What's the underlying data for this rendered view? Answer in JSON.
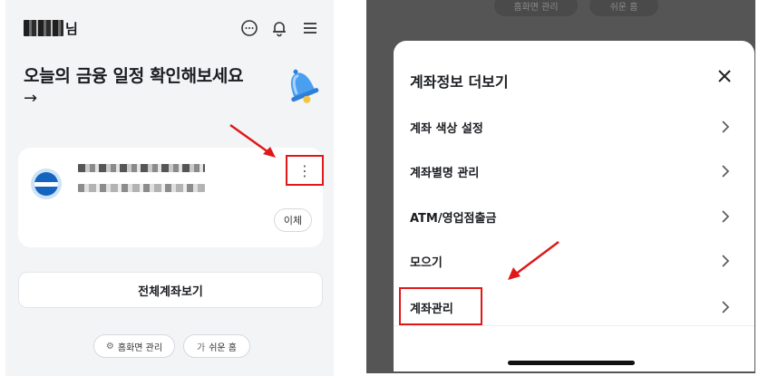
{
  "left": {
    "header": {
      "user_suffix": "님",
      "icons": [
        "chat-icon",
        "bell-icon",
        "menu-icon"
      ]
    },
    "headline": "오늘의 금융 일정 확인해보세요",
    "headline_arrow": "→",
    "account_card": {
      "more_glyph": "⋮",
      "transfer_label": "이체"
    },
    "all_accounts_label": "전체계좌보기",
    "chips": [
      {
        "glyph": "⚙",
        "label": "홈화면 관리"
      },
      {
        "glyph": "가",
        "label": "쉬운 홈"
      }
    ]
  },
  "right": {
    "background_chips": [
      "홈화면 관리",
      "쉬운 홈"
    ],
    "sheet": {
      "title": "계좌정보 더보기",
      "close_glyph": "✕",
      "items": [
        {
          "label": "계좌 색상 설정"
        },
        {
          "label": "계좌별명 관리"
        },
        {
          "label": "ATM/영업점출금"
        },
        {
          "label": "모으기"
        },
        {
          "label": "계좌관리"
        }
      ]
    }
  },
  "colors": {
    "highlight_red": "#e01818",
    "left_bg": "#f2f4f6",
    "overlay": "#555555"
  }
}
